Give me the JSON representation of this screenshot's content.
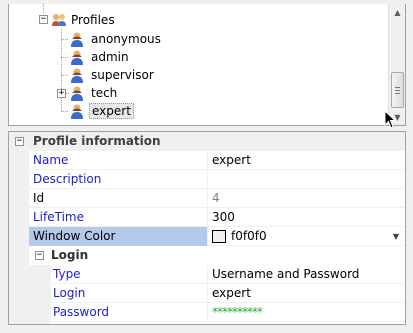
{
  "tree": {
    "root": {
      "label": "Profiles",
      "expander": "−",
      "icon": "users-group-icon"
    },
    "items": [
      {
        "label": "anonymous",
        "icon": "user-icon"
      },
      {
        "label": "admin",
        "icon": "user-icon"
      },
      {
        "label": "supervisor",
        "icon": "user-icon"
      },
      {
        "label": "tech",
        "icon": "user-icon",
        "expander": "+"
      },
      {
        "label": "expert",
        "icon": "user-icon",
        "selected": true
      }
    ]
  },
  "grid": {
    "category": {
      "label": "Profile information",
      "expander": "−"
    },
    "rows": [
      {
        "name": "Name",
        "value": "expert"
      },
      {
        "name": "Description",
        "value": ""
      },
      {
        "name": "Id",
        "value": "4"
      },
      {
        "name": "LifeTime",
        "value": "300"
      },
      {
        "name": "Window Color",
        "value": "f0f0f0",
        "color": "#f0f0f0"
      }
    ],
    "subcategory": {
      "label": "Login",
      "expander": "−"
    },
    "subrows": [
      {
        "name": "Type",
        "value": "Username and Password"
      },
      {
        "name": "Login",
        "value": "expert"
      },
      {
        "name": "Password",
        "value": "**********"
      }
    ]
  },
  "colors": {
    "blue_label": "#1c1cc8",
    "selection": "#b4c8e8",
    "password_green": "#2aa52a"
  }
}
